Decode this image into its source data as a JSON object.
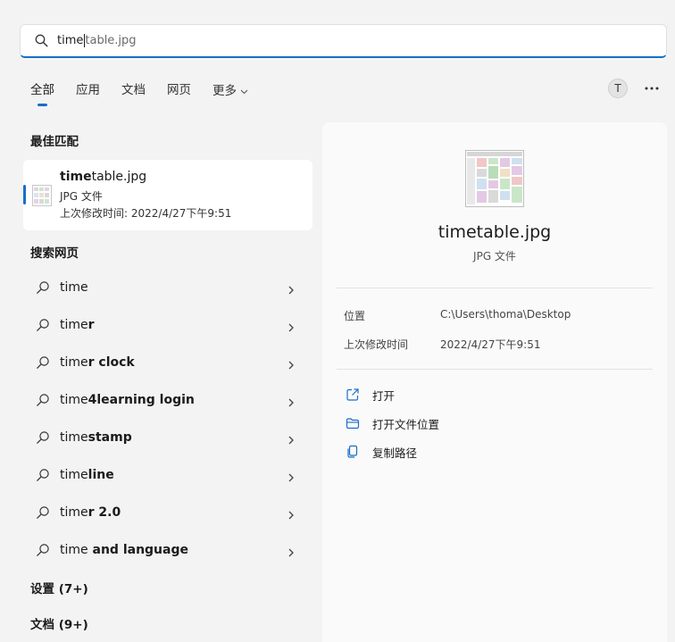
{
  "search": {
    "typed": "time",
    "completion": "table.jpg"
  },
  "tabs": [
    {
      "label": "全部"
    },
    {
      "label": "应用"
    },
    {
      "label": "文档"
    },
    {
      "label": "网页"
    },
    {
      "label": "更多"
    }
  ],
  "user": {
    "initial": "T"
  },
  "best_match": {
    "heading": "最佳匹配",
    "name_bold": "time",
    "name_rest": "table.jpg",
    "type": "JPG 文件",
    "modified": "上次修改时间: 2022/4/27下午9:51"
  },
  "web": {
    "heading": "搜索网页",
    "items": [
      {
        "prefix": "time",
        "suffix": ""
      },
      {
        "prefix": "time",
        "suffix": "r"
      },
      {
        "prefix": "time",
        "suffix": "r clock"
      },
      {
        "prefix": "time",
        "suffix": "4learning login"
      },
      {
        "prefix": "time",
        "suffix": "stamp"
      },
      {
        "prefix": "time",
        "suffix": "line"
      },
      {
        "prefix": "time",
        "suffix": "r 2.0"
      },
      {
        "prefix": "time",
        "suffix": " and language"
      }
    ]
  },
  "settings_heading": "设置 (7+)",
  "docs_heading": "文档 (9+)",
  "preview": {
    "name": "timetable.jpg",
    "type": "JPG 文件",
    "location_label": "位置",
    "location_value": "C:\\Users\\thoma\\Desktop",
    "modified_label": "上次修改时间",
    "modified_value": "2022/4/27下午9:51",
    "actions": [
      {
        "label": "打开",
        "icon": "open-external-icon"
      },
      {
        "label": "打开文件位置",
        "icon": "folder-icon"
      },
      {
        "label": "复制路径",
        "icon": "copy-icon"
      }
    ]
  },
  "colors": {
    "accent": "#1a6ec7",
    "background": "#f3f3f3",
    "panel": "#fafafa"
  }
}
